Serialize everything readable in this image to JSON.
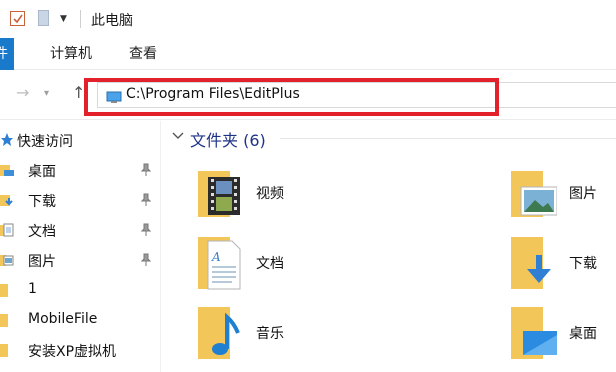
{
  "window": {
    "title": "此电脑"
  },
  "ribbon": {
    "tabs": [
      "件",
      "计算机",
      "查看"
    ]
  },
  "address": {
    "path": "C:\\Program Files\\EditPlus"
  },
  "navpane": {
    "quick_access": "快速访问",
    "items": [
      {
        "label": "桌面",
        "icon": "desktop-folder-icon",
        "pinned": true
      },
      {
        "label": "下载",
        "icon": "downloads-folder-icon",
        "pinned": true
      },
      {
        "label": "文档",
        "icon": "documents-folder-icon",
        "pinned": true
      },
      {
        "label": "图片",
        "icon": "pictures-folder-icon",
        "pinned": true
      },
      {
        "label": "1",
        "icon": "folder-icon",
        "pinned": false
      },
      {
        "label": "MobileFile",
        "icon": "folder-icon",
        "pinned": false
      },
      {
        "label": "安装XP虚拟机",
        "icon": "folder-icon",
        "pinned": false
      }
    ]
  },
  "content": {
    "group_label": "文件夹 (6)",
    "folders": [
      {
        "label": "视频",
        "icon": "videos-folder-icon"
      },
      {
        "label": "图片",
        "icon": "pictures-folder-icon"
      },
      {
        "label": "文档",
        "icon": "documents-folder-icon"
      },
      {
        "label": "下载",
        "icon": "downloads-folder-icon"
      },
      {
        "label": "音乐",
        "icon": "music-folder-icon"
      },
      {
        "label": "桌面",
        "icon": "desktop-folder-icon"
      }
    ]
  },
  "colors": {
    "accent": "#1979ca",
    "highlight_box": "#e2212b",
    "group_text": "#1e3287",
    "folder": "#f3c65a"
  }
}
